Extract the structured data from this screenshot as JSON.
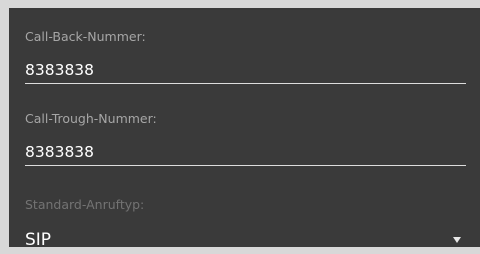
{
  "callback": {
    "label": "Call-Back-Nummer:",
    "value": "8383838"
  },
  "calltrough": {
    "label": "Call-Trough-Nummer:",
    "value": "8383838"
  },
  "calltype": {
    "label": "Standard-Anruftyp:",
    "selected": "SIP",
    "icon": "dropdown-arrow-icon"
  },
  "colors": {
    "panel": "#3a3a3a",
    "label": "#a6a6a6",
    "disabled_label": "#737373",
    "text": "#ffffff",
    "underline": "#dcdcdc"
  }
}
